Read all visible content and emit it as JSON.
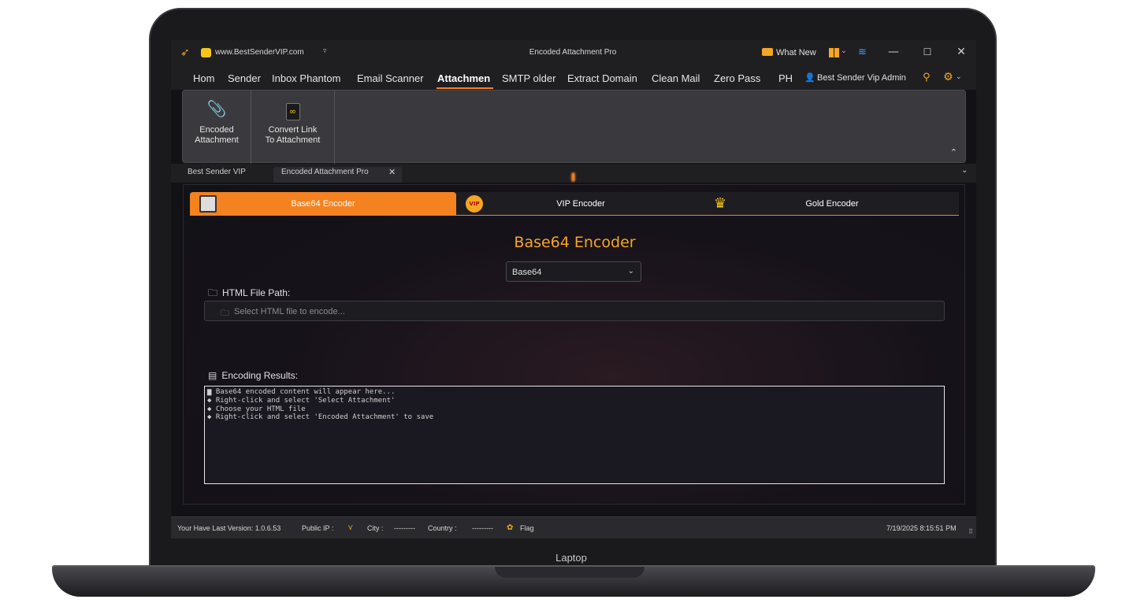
{
  "laptop_label": "Laptop",
  "titlebar": {
    "site": "www.BestSenderVIP.com",
    "title": "Encoded Attachment Pro",
    "whats_new": "What New",
    "minimize": "—",
    "maximize": "☐",
    "close": "✕"
  },
  "menu": {
    "items": [
      "Hom",
      "Sender",
      "Inbox Phantom",
      "Email Scanner",
      "Attachmen",
      "SMTP older",
      "Extract Domain",
      "Clean Mail",
      "Zero Pass",
      "PH"
    ],
    "active": "Attachmen",
    "admin": "Best Sender Vip Admin"
  },
  "ribbon": {
    "buttons": [
      {
        "label_line1": "Encoded",
        "label_line2": "Attachment",
        "icon": "paperclip-icon"
      },
      {
        "label_line1": "Convert Link",
        "label_line2": "To Attachment",
        "icon": "link-file-icon"
      }
    ]
  },
  "doc_tabs": [
    "Best Sender VIP",
    "Encoded Attachment Pro"
  ],
  "encoder_tabs": [
    "Base64 Encoder",
    "VIP Encoder",
    "Gold Encoder"
  ],
  "vip_badge": "VIP",
  "main": {
    "title": "Base64 Encoder",
    "method": "Base64",
    "file_path_label": "HTML File Path:",
    "file_path_placeholder": "Select HTML file to encode...",
    "results_label": "Encoding Results:",
    "results_lines": [
      "▆ Base64 encoded content will appear here...",
      "",
      "◆ Right-click and select 'Select Attachment'",
      "◆ Choose your HTML file",
      "◆ Right-click and select 'Encoded Attachment' to save"
    ]
  },
  "statusbar": {
    "version": "Your Have Last Version: 1.0.6.53",
    "public_ip_label": "Public IP :",
    "city_label": "City :",
    "city_value": "---------",
    "country_label": "Country :",
    "country_value": "---------",
    "flag_label": "Flag",
    "datetime": "7/19/2025 8:15:51 PM"
  },
  "colors": {
    "accent": "#f58220",
    "gold": "#f5a623",
    "background": "#121216"
  }
}
